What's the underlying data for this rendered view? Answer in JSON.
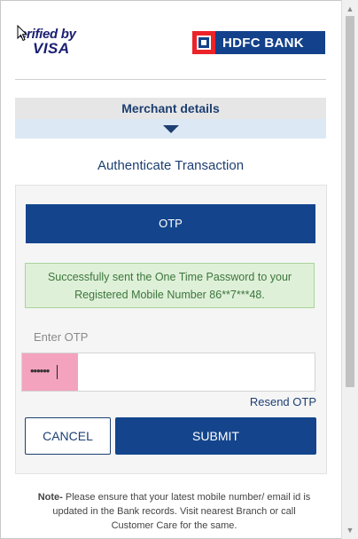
{
  "header": {
    "visa_line1": "erified by",
    "visa_line2": "VISA",
    "bank_name": "HDFC BANK"
  },
  "merchant": {
    "label": "Merchant details",
    "toggle_icon": "triangle-down-icon"
  },
  "auth": {
    "title": "Authenticate Transaction"
  },
  "otp_panel": {
    "header": "OTP",
    "success_line1": "Successfully sent the One Time Password to your",
    "success_line2": "Registered Mobile Number 86**7***48.",
    "input_label": "Enter OTP",
    "input_value": "••••••",
    "resend_label": "Resend OTP",
    "cancel_label": "CANCEL",
    "submit_label": "SUBMIT"
  },
  "note": {
    "prefix": "Note-",
    "text": " Please ensure that your latest mobile number/ email id is updated in the Bank records. Visit nearest Branch or call Customer Care for the same."
  },
  "colors": {
    "primary": "#14458c",
    "text_blue": "#1d3f72",
    "hdfc_red": "#ed232a",
    "success_bg": "#dff0d8",
    "success_text": "#3c763d",
    "input_highlight": "#f4a3bf"
  }
}
